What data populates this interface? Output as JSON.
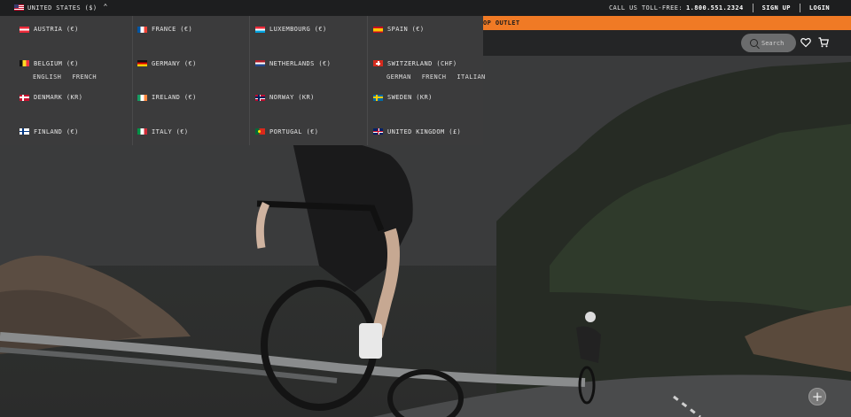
{
  "header": {
    "locale": {
      "label": "UNITED STATES ($)",
      "flag": "flag-us-icon"
    },
    "phone_label": "CALL US TOLL-FREE:",
    "phone_number": "1.800.551.2324",
    "sign_up": "SIGN UP",
    "login": "LOGIN"
  },
  "promo": {
    "text": "OP OUTLET"
  },
  "search": {
    "placeholder": "Search"
  },
  "countries": [
    {
      "label": "AUSTRIA (€)",
      "flag": "flag-austria-icon"
    },
    {
      "label": "FRANCE (€)",
      "flag": "flag-france-icon"
    },
    {
      "label": "LUXEMBOURG (€)",
      "flag": "flag-luxembourg-icon"
    },
    {
      "label": "SPAIN (€)",
      "flag": "flag-spain-icon"
    },
    {
      "label": "BELGIUM (€)",
      "flag": "flag-belgium-icon",
      "languages": [
        "ENGLISH",
        "FRENCH"
      ]
    },
    {
      "label": "GERMANY (€)",
      "flag": "flag-germany-icon"
    },
    {
      "label": "NETHERLANDS (€)",
      "flag": "flag-netherlands-icon"
    },
    {
      "label": "SWITZERLAND (CHF)",
      "flag": "flag-switzerland-icon",
      "languages": [
        "GERMAN",
        "FRENCH",
        "ITALIAN"
      ]
    },
    {
      "label": "DENMARK (KR)",
      "flag": "flag-denmark-icon"
    },
    {
      "label": "IRELAND (€)",
      "flag": "flag-ireland-icon"
    },
    {
      "label": "NORWAY (KR)",
      "flag": "flag-norway-icon"
    },
    {
      "label": "SWEDEN (KR)",
      "flag": "flag-sweden-icon"
    },
    {
      "label": "FINLAND (€)",
      "flag": "flag-finland-icon"
    },
    {
      "label": "ITALY (€)",
      "flag": "flag-italy-icon"
    },
    {
      "label": "PORTUGAL (€)",
      "flag": "flag-portugal-icon"
    },
    {
      "label": "UNITED KINGDOM (£)",
      "flag": "flag-uk-icon"
    }
  ],
  "colors": {
    "promo_bar": "#f07a25",
    "dropdown_bg": "#3b3b3c"
  },
  "hero": {
    "plus_button": "+"
  }
}
